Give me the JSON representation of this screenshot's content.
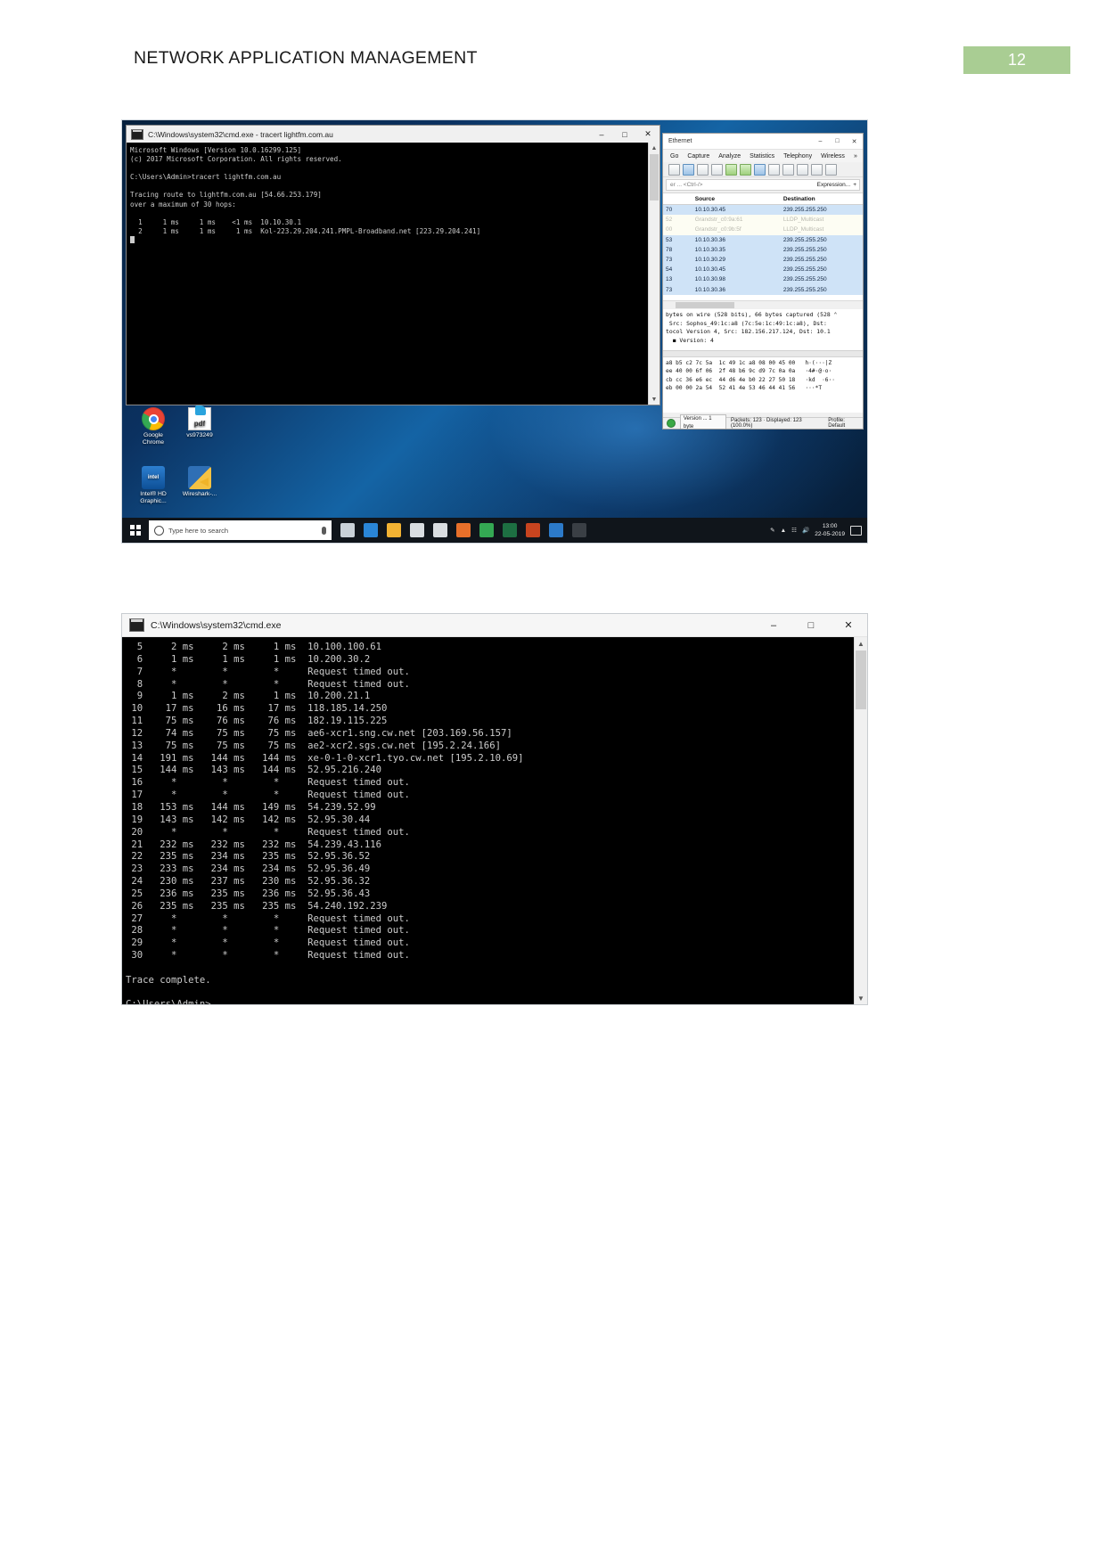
{
  "document": {
    "header_title": "NETWORK APPLICATION MANAGEMENT",
    "page_number": "12",
    "accent_color": "#a9cd93"
  },
  "figure1": {
    "cmd_window": {
      "title": "C:\\Windows\\system32\\cmd.exe - tracert  lightfm.com.au",
      "minimize_label": "–",
      "maximize_label": "□",
      "close_label": "✕",
      "lines": [
        "Microsoft Windows [Version 10.0.16299.125]",
        "(c) 2017 Microsoft Corporation. All rights reserved.",
        "",
        "C:\\Users\\Admin>tracert lightfm.com.au",
        "",
        "Tracing route to lightfm.com.au [54.66.253.179]",
        "over a maximum of 30 hops:",
        "",
        "  1     1 ms     1 ms    <1 ms  10.10.30.1",
        "  2     1 ms     1 ms     1 ms  Kol-223.29.204.241.PMPL-Broadband.net [223.29.204.241]"
      ]
    },
    "wireshark": {
      "title": "Ethernet",
      "minimize_label": "–",
      "maximize_label": "□",
      "close_label": "✕",
      "menus": [
        "Go",
        "Capture",
        "Analyze",
        "Statistics",
        "Telephony",
        "Wireless",
        "»"
      ],
      "filter_placeholder": "er ... <Ctrl-/>",
      "expression_label": "Expression...",
      "expression_plus": "+",
      "columns": [
        "",
        "Source",
        "Destination"
      ],
      "packets": [
        {
          "no": "70",
          "source": "10.10.30.45",
          "destination": "239.255.255.250",
          "pale": false
        },
        {
          "no": "52",
          "source": "Grandstr_c0:9a:61",
          "destination": "LLDP_Multicast",
          "pale": true
        },
        {
          "no": "00",
          "source": "Grandstr_c0:9b:5f",
          "destination": "LLDP_Multicast",
          "pale": true
        },
        {
          "no": "53",
          "source": "10.10.30.36",
          "destination": "239.255.255.250",
          "pale": false
        },
        {
          "no": "78",
          "source": "10.10.30.35",
          "destination": "239.255.255.250",
          "pale": false
        },
        {
          "no": "73",
          "source": "10.10.30.29",
          "destination": "239.255.255.250",
          "pale": false
        },
        {
          "no": "54",
          "source": "10.10.30.45",
          "destination": "239.255.255.250",
          "pale": false
        },
        {
          "no": "13",
          "source": "10.10.30.98",
          "destination": "239.255.255.250",
          "pale": false
        },
        {
          "no": "73",
          "source": "10.10.30.36",
          "destination": "239.255.255.250",
          "pale": false
        }
      ],
      "detail_lines": [
        "bytes on wire (528 bits), 66 bytes captured (528 ⌃",
        " Src: Sophos_49:1c:a8 (7c:5e:1c:49:1c:a8), Dst:",
        "tocol Version 4, Src: 182.156.217.124, Dst: 10.1",
        "  ◼ Version: 4"
      ],
      "bytes_lines": [
        "a8 b5 c2 7c 5a  1c 49 1c a8 08 00 45 00   h·(···|Z",
        "ee 40 00 6f 06  2f 48 b6 9c d9 7c 0a 0a   ·4#·@·o·",
        "cb cc 36 e6 ec  44 d6 4e b0 22 27 50 18   ·kd  ·6··",
        "eb 00 00 2a 54  52 41 4e 53 46 44 41 56   ···*T"
      ],
      "status": {
        "version": "Version ... 1 byte",
        "packets": "Packets: 123 · Displayed: 123 (100.0%)",
        "profile": "Profile: Default"
      }
    },
    "desktop_icons": [
      {
        "label": "Google\nChrome",
        "icon": "chrome-icon"
      },
      {
        "label": "vs973249",
        "icon": "pdf-file-icon"
      },
      {
        "label": "Intel® HD\nGraphic...",
        "icon": "intel-graphics-icon"
      },
      {
        "label": "Wireshark-...",
        "icon": "wireshark-icon"
      }
    ],
    "taskbar": {
      "search_placeholder": "Type here to search",
      "clock_time": "13:00",
      "clock_date": "22-05-2019",
      "pinned": [
        {
          "name": "task-view",
          "color": "#c9d1d8"
        },
        {
          "name": "edge",
          "color": "#2a86d8"
        },
        {
          "name": "file-explorer",
          "color": "#f2b233"
        },
        {
          "name": "store",
          "color": "#d9dde1"
        },
        {
          "name": "mail",
          "color": "#d9dde1"
        },
        {
          "name": "firefox",
          "color": "#e8702a"
        },
        {
          "name": "chrome",
          "color": "#34a853"
        },
        {
          "name": "excel",
          "color": "#1d6f42"
        },
        {
          "name": "powerpoint",
          "color": "#c7441f"
        },
        {
          "name": "sticky-notes",
          "color": "#2c7ac9"
        },
        {
          "name": "command-prompt",
          "color": "#3a3f45"
        }
      ]
    }
  },
  "figure2": {
    "title": "C:\\Windows\\system32\\cmd.exe",
    "minimize_label": "–",
    "maximize_label": "□",
    "close_label": "✕",
    "lines": [
      "  5     2 ms     2 ms     1 ms  10.100.100.61",
      "  6     1 ms     1 ms     1 ms  10.200.30.2",
      "  7     *        *        *     Request timed out.",
      "  8     *        *        *     Request timed out.",
      "  9     1 ms     2 ms     1 ms  10.200.21.1",
      " 10    17 ms    16 ms    17 ms  118.185.14.250",
      " 11    75 ms    76 ms    76 ms  182.19.115.225",
      " 12    74 ms    75 ms    75 ms  ae6-xcr1.sng.cw.net [203.169.56.157]",
      " 13    75 ms    75 ms    75 ms  ae2-xcr2.sgs.cw.net [195.2.24.166]",
      " 14   191 ms   144 ms   144 ms  xe-0-1-0-xcr1.tyo.cw.net [195.2.10.69]",
      " 15   144 ms   143 ms   144 ms  52.95.216.240",
      " 16     *        *        *     Request timed out.",
      " 17     *        *        *     Request timed out.",
      " 18   153 ms   144 ms   149 ms  54.239.52.99",
      " 19   143 ms   142 ms   142 ms  52.95.30.44",
      " 20     *        *        *     Request timed out.",
      " 21   232 ms   232 ms   232 ms  54.239.43.116",
      " 22   235 ms   234 ms   235 ms  52.95.36.52",
      " 23   233 ms   234 ms   234 ms  52.95.36.49",
      " 24   230 ms   237 ms   230 ms  52.95.36.32",
      " 25   236 ms   235 ms   236 ms  52.95.36.43",
      " 26   235 ms   235 ms   235 ms  54.240.192.239",
      " 27     *        *        *     Request timed out.",
      " 28     *        *        *     Request timed out.",
      " 29     *        *        *     Request timed out.",
      " 30     *        *        *     Request timed out.",
      "",
      "Trace complete.",
      "",
      "C:\\Users\\Admin>"
    ]
  }
}
